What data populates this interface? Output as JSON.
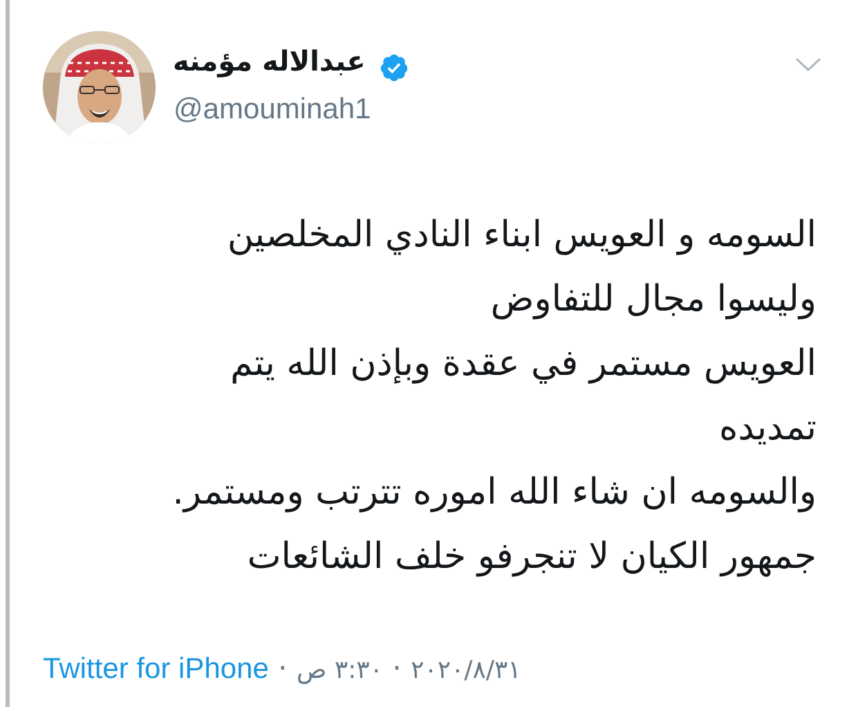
{
  "tweet": {
    "display_name": "عبدالاله مؤمنه",
    "handle": "@amouminah1",
    "verified": true,
    "lines": [
      "السومه و العويس ابناء النادي المخلصين",
      "وليسوا مجال للتفاوض",
      "العويس مستمر في عقدة وبإذن الله يتم",
      "تمديده",
      "والسومه ان شاء الله اموره تترتب ومستمر.",
      "جمهور الكيان لا تنجرفو خلف الشائعات"
    ],
    "source": "Twitter for iPhone",
    "separator": "·",
    "date": "٢٠٢٠/٨/٣١",
    "time": "٣:٣٠ ص"
  },
  "colors": {
    "verified_badge": "#1da1f2",
    "link": "#1b95e0",
    "secondary_text": "#657786",
    "primary_text": "#14171a"
  },
  "icons": {
    "avatar": "avatar",
    "verified": "verified-badge-icon",
    "menu": "chevron-down-icon"
  }
}
